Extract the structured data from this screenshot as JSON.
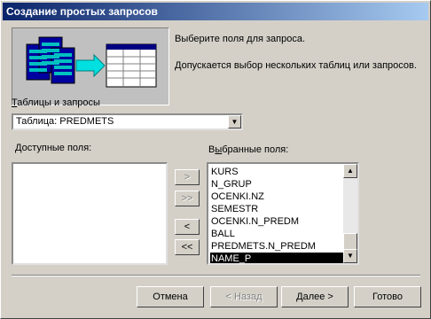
{
  "window": {
    "title": "Создание простых запросов"
  },
  "intro": {
    "line1": "Выберите поля для запроса.",
    "line2": "Допускается выбор нескольких таблиц или запросов."
  },
  "source": {
    "label_accel": "Т",
    "label_rest": "аблицы и запросы",
    "value": "Таблица: PREDMETS"
  },
  "available": {
    "label_accel": "Д",
    "label_rest": "оступные поля:",
    "items": []
  },
  "selected": {
    "label_pre": "В",
    "label_accel": "ы",
    "label_rest": "бранные поля:",
    "items": [
      "KURS",
      "N_GRUP",
      "OCENKI.NZ",
      "SEMESTR",
      "OCENKI.N_PREDM",
      "BALL",
      "PREDMETS.N_PREDM",
      "NAME_P"
    ],
    "selected_item": "NAME_P"
  },
  "move": {
    "add_one": ">",
    "add_all": ">>",
    "remove_one": "<",
    "remove_all": "<<"
  },
  "buttons": {
    "cancel": "Отмена",
    "back": "< Назад",
    "next": "Далее >",
    "finish": "Готово"
  },
  "colors": {
    "titlebar_start": "#0a246a",
    "titlebar_end": "#a6caf0",
    "face": "#d4d0c8"
  }
}
